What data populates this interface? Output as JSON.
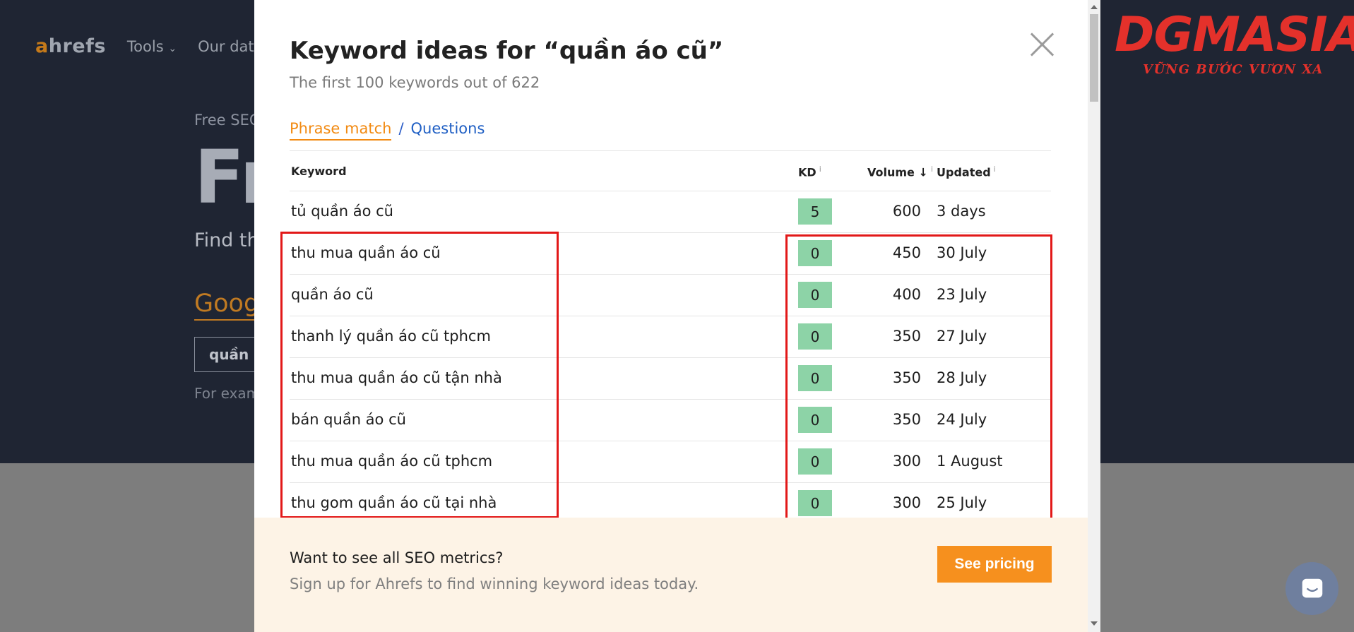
{
  "background": {
    "logo_a": "a",
    "logo_rest": "hrefs",
    "nav": [
      "Tools",
      "Our dat"
    ],
    "free_label": "Free SEC",
    "big_title": "Fr",
    "find_text": "Find th",
    "google_text": "Goog",
    "input_value": "quần a",
    "example_text": "For exam"
  },
  "brand": {
    "name": "DGMASIA",
    "slogan": "VỮNG BƯỚC VƯƠN XA"
  },
  "modal": {
    "title": "Keyword ideas for “quần áo cũ”",
    "subtitle": "The first 100 keywords out of 622",
    "tabs": {
      "phrase": "Phrase match",
      "separator": "/",
      "questions": "Questions"
    },
    "columns": {
      "keyword": "Keyword",
      "kd": "KD",
      "volume": "Volume",
      "volume_arrow": "↓",
      "updated": "Updated",
      "info": "i"
    },
    "rows": [
      {
        "keyword": "tủ quần áo cũ",
        "kd": "5",
        "volume": "600",
        "updated": "3 days"
      },
      {
        "keyword": "thu mua quần áo cũ",
        "kd": "0",
        "volume": "450",
        "updated": "30 July"
      },
      {
        "keyword": "quần áo cũ",
        "kd": "0",
        "volume": "400",
        "updated": "23 July"
      },
      {
        "keyword": "thanh lý quần áo cũ tphcm",
        "kd": "0",
        "volume": "350",
        "updated": "27 July"
      },
      {
        "keyword": "thu mua quần áo cũ tận nhà",
        "kd": "0",
        "volume": "350",
        "updated": "28 July"
      },
      {
        "keyword": "bán quần áo cũ",
        "kd": "0",
        "volume": "350",
        "updated": "24 July"
      },
      {
        "keyword": "thu mua quần áo cũ tphcm",
        "kd": "0",
        "volume": "300",
        "updated": "1 August"
      },
      {
        "keyword": "thu gom quần áo cũ tại nhà",
        "kd": "0",
        "volume": "300",
        "updated": "25 July"
      }
    ],
    "footer": {
      "question": "Want to see all SEO metrics?",
      "subtext": "Sign up for Ahrefs to find winning keyword ideas today.",
      "button": "See pricing"
    }
  },
  "colors": {
    "accent": "#f28a12",
    "link": "#1f5fc4",
    "kd_badge": "#8dd3a7",
    "highlight": "#e21818"
  }
}
